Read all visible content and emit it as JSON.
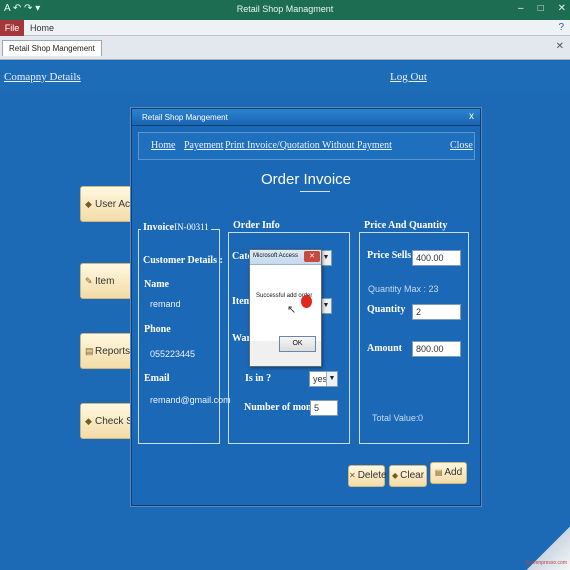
{
  "window": {
    "title": "Retail Shop Managment"
  },
  "ribbon": {
    "file": "File",
    "home": "Home"
  },
  "doc_tab": "Retail Shop Mangement",
  "main_form": {
    "company_link": "Comapny Details",
    "logout_link": "Log Out",
    "side_buttons": [
      "User Account",
      "Item",
      "Reports",
      "Check Supplier"
    ]
  },
  "invoice_form": {
    "title": "Retail Shop Mangement",
    "nav": [
      "Home",
      "Payement",
      "Print Invoice/Quotation Without Payment",
      "Close"
    ],
    "heading": "Order Invoice",
    "invoice_group": {
      "title": "Invoice",
      "invoice_no": "IN-00311",
      "customer_details": "Customer Details :",
      "name_label": "Name",
      "name": "remand",
      "phone_label": "Phone",
      "phone": "055223445",
      "email_label": "Email",
      "email": "remand@gmail.com"
    },
    "order_group": {
      "title": "Order Info",
      "category_label": "Cate",
      "item_label": "Item",
      "warranty_label": "Warr",
      "is_in_label": "Is in ?",
      "is_in_value": "yes",
      "months_label": "Number of month",
      "months_value": "5"
    },
    "price_group": {
      "title": "Price And Quantity",
      "price_label": "Price Sells",
      "price_value": "400.00",
      "qty_max": "Quantity Max : 23",
      "qty_label": "Quantity",
      "qty_value": "2",
      "amount_label": "Amount",
      "amount_value": "800.00",
      "total_label": "Total Value:",
      "total_value": "0"
    },
    "buttons": {
      "delete": "Delete",
      "clear": "Clear",
      "add": "Add"
    }
  },
  "msgbox": {
    "title": "Microsoft Access",
    "message": "Successful add order",
    "ok": "OK"
  },
  "watermark": "Screenpresso.com",
  "colors": {
    "form_bg": "#1b68b6",
    "access_green": "#1d6d52",
    "file_tab": "#a4373a",
    "button_face": "#f3dca8"
  }
}
